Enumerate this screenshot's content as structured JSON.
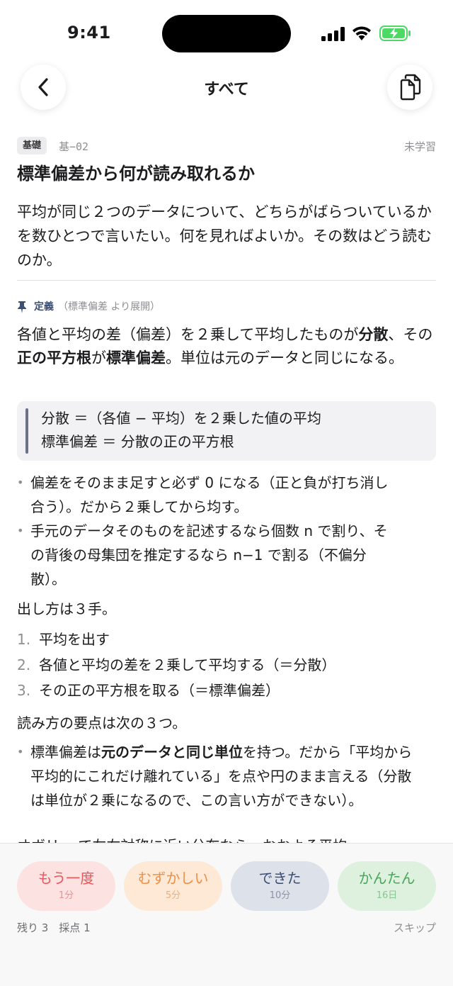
{
  "status_bar": {
    "time": "9:41"
  },
  "nav": {
    "title": "すべて"
  },
  "card": {
    "level_tag": "基礎",
    "id": "基−02",
    "status": "未学習",
    "title": "標準偏差から何が読み取れるか",
    "question": "平均が同じ２つのデータについて、どちらがばらついているかを数ひとつで言いたい。何を見ればよいか。その数はどう読むのか。"
  },
  "definition": {
    "label": "定義",
    "source": "（標準偏差 より展開）",
    "body": {
      "s1": "各値と平均の差（偏差）を２乗して平均したものが",
      "s2": "分散",
      "s3": "、その",
      "s4": "正の平方根",
      "s5": "が",
      "s6": "標準偏差",
      "s7": "。単位は元のデータと同じになる。"
    },
    "formula_line1": "分散 ＝（各値 − 平均）を２乗した値の平均",
    "formula_line2": "標準偏差 ＝ 分散の正の平方根"
  },
  "notes": [
    "偏差をそのまま足すと必ず 0 になる（正と負が打ち消し合う）。だから２乗してから均す。",
    "手元のデータそのものを記述するなら個数 n で割り、その背後の母集団を推定するなら n−1 で割る（不偏分散）。"
  ],
  "steps_intro": "出し方は３手。",
  "steps": [
    {
      "num": "1.",
      "text": "平均を出す"
    },
    {
      "num": "2.",
      "text": "各値と平均の差を２乗して平均する（＝分散）"
    },
    {
      "num": "3.",
      "text": "その正の平方根を取る（＝標準偏差）"
    }
  ],
  "reading_intro": "読み方の要点は次の３つ。",
  "reading_point": {
    "s1": "標準偏差は",
    "s2": "元のデータと同じ単位",
    "s3": "を持つ。だから「平均から平均的にこれだけ離れている」を点や円のまま言える（分散は単位が２乗になるので、この言い方ができない）。"
  },
  "next_line_peek": "オボリ… で左右対称に近い分布なら、おおよそ平均",
  "rating": {
    "again": {
      "label": "もう一度",
      "interval": "1分"
    },
    "hard": {
      "label": "むずかしい",
      "interval": "5分"
    },
    "good": {
      "label": "できた",
      "interval": "10分"
    },
    "easy": {
      "label": "かんたん",
      "interval": "16日"
    }
  },
  "footer": {
    "remaining": "残り 3　採点 1",
    "skip": "スキップ"
  }
}
